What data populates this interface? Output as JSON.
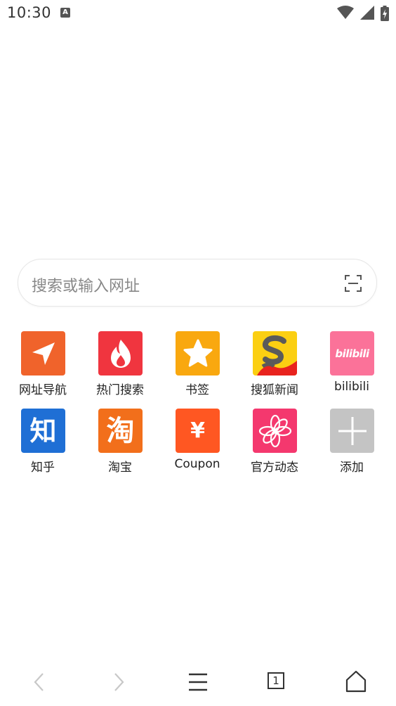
{
  "status_bar": {
    "time": "10:30",
    "notification_icon_letter": "A",
    "icons": [
      "wifi-icon",
      "cell-signal-icon",
      "battery-charging-icon"
    ]
  },
  "search": {
    "placeholder": "搜索或输入网址",
    "scan_icon": "scan-icon"
  },
  "shortcuts": [
    {
      "label": "网址导航",
      "icon": "navigation-arrow-icon",
      "color": "#F0632B"
    },
    {
      "label": "热门搜索",
      "icon": "flame-icon",
      "color": "#F0353F"
    },
    {
      "label": "书签",
      "icon": "star-icon",
      "color": "#F9A80F"
    },
    {
      "label": "搜狐新闻",
      "icon": "sohu-logo-icon",
      "color": "#FBCF12"
    },
    {
      "label": "bilibili",
      "icon": "bilibili-logo-icon",
      "color": "#FB7299",
      "logo_text": "bilibili"
    },
    {
      "label": "知乎",
      "icon": "zhihu-logo-icon",
      "color": "#1F6FD5",
      "logo_text": "知"
    },
    {
      "label": "淘宝",
      "icon": "taobao-logo-icon",
      "color": "#F26F1B",
      "logo_text": "淘"
    },
    {
      "label": "Coupon",
      "icon": "yen-icon",
      "color": "#FF5722",
      "logo_text": "¥"
    },
    {
      "label": "官方动态",
      "icon": "flower-logo-icon",
      "color": "#F4386E"
    },
    {
      "label": "添加",
      "icon": "plus-icon",
      "color": "#C4C4C4"
    }
  ],
  "bottom_nav": {
    "back_icon": "back-arrow-icon",
    "forward_icon": "forward-arrow-icon",
    "menu_icon": "menu-icon",
    "tabs_count": "1",
    "home_icon": "home-icon"
  }
}
